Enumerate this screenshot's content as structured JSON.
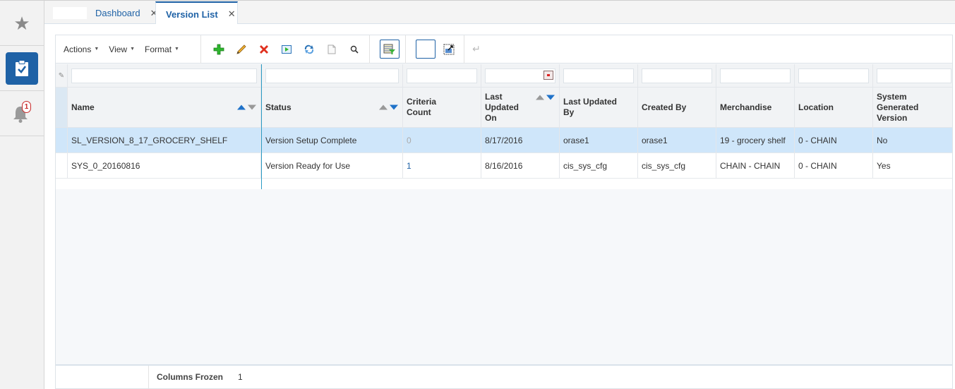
{
  "sidebar": {
    "items": [
      {
        "name": "favorites",
        "icon": "star-icon"
      },
      {
        "name": "tasks",
        "icon": "clipboard-check-icon",
        "active": true
      },
      {
        "name": "notifications",
        "icon": "bell-icon",
        "badge": "1"
      }
    ]
  },
  "tabs": [
    {
      "label": "Dashboard",
      "close": "✕",
      "active": false
    },
    {
      "label": "Version List",
      "close": "✕",
      "active": true
    }
  ],
  "toolbar": {
    "menus": [
      {
        "label": "Actions",
        "caret": "▼"
      },
      {
        "label": "View",
        "caret": "▼"
      },
      {
        "label": "Format",
        "caret": "▼"
      }
    ],
    "icons": [
      "add-icon",
      "edit-icon",
      "delete-icon",
      "run-icon",
      "refresh-icon",
      "copy-icon",
      "search-icon",
      "filter-icon",
      "blank-toggle",
      "detach-icon",
      "wrap-icon"
    ],
    "glyphs": {
      "add": "✚",
      "edit": "✎",
      "delete": "✖",
      "search": "⚲",
      "wrap": "↵"
    }
  },
  "table": {
    "columns": [
      {
        "label": "Name"
      },
      {
        "label": "Status"
      },
      {
        "label": "Criteria Count"
      },
      {
        "label": "Last Updated On"
      },
      {
        "label": "Last Updated By"
      },
      {
        "label": "Created By"
      },
      {
        "label": "Merchandise"
      },
      {
        "label": "Location"
      },
      {
        "label": "System Generated Version"
      }
    ],
    "rows": [
      {
        "selected": true,
        "cells": [
          "SL_VERSION_8_17_GROCERY_SHELF",
          "Version Setup Complete",
          "0",
          "8/17/2016",
          "orase1",
          "orase1",
          "19 - grocery shelf",
          "0 - CHAIN",
          "No"
        ]
      },
      {
        "selected": false,
        "cells": [
          "SYS_0_20160816",
          "Version Ready for Use",
          "1",
          "8/16/2016",
          "cis_sys_cfg",
          "cis_sys_cfg",
          "CHAIN - CHAIN",
          "0 - CHAIN",
          "Yes"
        ]
      }
    ]
  },
  "footer": {
    "columns_frozen_label": "Columns Frozen",
    "columns_frozen_value": "1"
  },
  "colors": {
    "accent": "#1f62a6",
    "selected_row": "#cfe6fa",
    "badge": "#c82828"
  }
}
